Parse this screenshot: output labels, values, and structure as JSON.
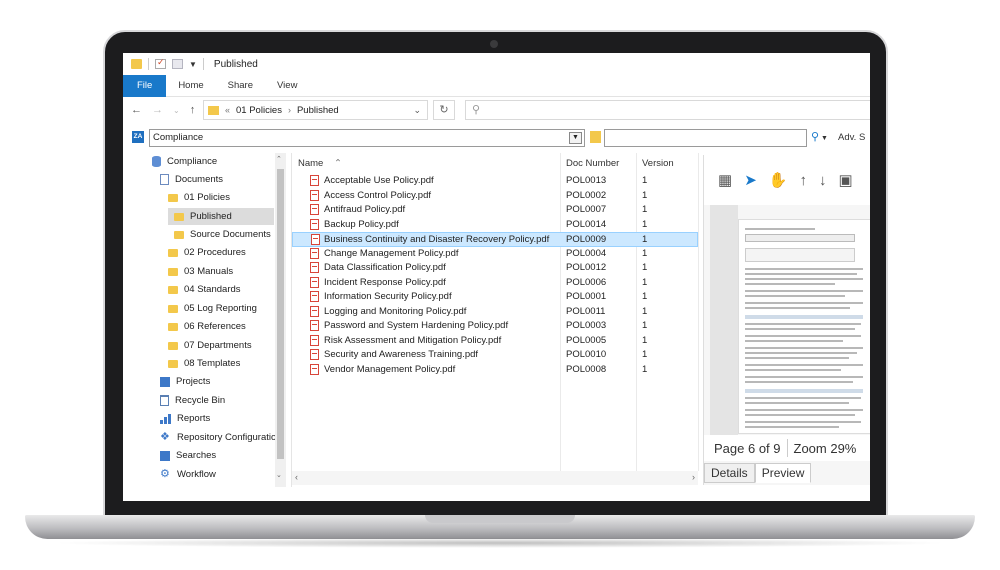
{
  "window": {
    "title": "Published"
  },
  "ribbon": {
    "tabs": [
      "File",
      "Home",
      "Share",
      "View"
    ]
  },
  "address": {
    "path": [
      "01 Policies",
      "Published"
    ]
  },
  "compliance_bar": {
    "repository": "Compliance",
    "logo": "ZA",
    "advanced_label": "Adv. S"
  },
  "nav_pane": {
    "items": [
      {
        "label": "Compliance",
        "icon": "database-icon"
      },
      {
        "label": "Documents",
        "icon": "document-icon"
      },
      {
        "label": "01 Policies",
        "icon": "folder-icon"
      },
      {
        "label": "Published",
        "icon": "folder-icon",
        "selected": true
      },
      {
        "label": "Source Documents",
        "icon": "folder-icon"
      },
      {
        "label": "02 Procedures",
        "icon": "folder-icon"
      },
      {
        "label": "03 Manuals",
        "icon": "folder-icon"
      },
      {
        "label": "04 Standards",
        "icon": "folder-icon"
      },
      {
        "label": "05 Log Reporting",
        "icon": "folder-icon"
      },
      {
        "label": "06 References",
        "icon": "folder-icon"
      },
      {
        "label": "07 Departments",
        "icon": "folder-icon"
      },
      {
        "label": "08 Templates",
        "icon": "folder-icon"
      },
      {
        "label": "Projects",
        "icon": "projects-icon"
      },
      {
        "label": "Recycle Bin",
        "icon": "recycle-bin-icon"
      },
      {
        "label": "Reports",
        "icon": "bar-chart-icon"
      },
      {
        "label": "Repository Configuration",
        "icon": "config-icon"
      },
      {
        "label": "Searches",
        "icon": "search-folder-icon"
      },
      {
        "label": "Workflow",
        "icon": "gear-icon"
      }
    ]
  },
  "file_list": {
    "columns": [
      "Name",
      "Doc Number",
      "Version"
    ],
    "rows": [
      {
        "name": "Acceptable Use Policy.pdf",
        "doc": "POL0013",
        "version": "1"
      },
      {
        "name": "Access Control Policy.pdf",
        "doc": "POL0002",
        "version": "1"
      },
      {
        "name": "Antifraud Policy.pdf",
        "doc": "POL0007",
        "version": "1"
      },
      {
        "name": "Backup Policy.pdf",
        "doc": "POL0014",
        "version": "1"
      },
      {
        "name": "Business Continuity and Disaster Recovery Policy.pdf",
        "doc": "POL0009",
        "version": "1",
        "selected": true
      },
      {
        "name": "Change Management Policy.pdf",
        "doc": "POL0004",
        "version": "1"
      },
      {
        "name": "Data Classification Policy.pdf",
        "doc": "POL0012",
        "version": "1"
      },
      {
        "name": "Incident Response Policy.pdf",
        "doc": "POL0006",
        "version": "1"
      },
      {
        "name": "Information Security Policy.pdf",
        "doc": "POL0001",
        "version": "1"
      },
      {
        "name": "Logging and Monitoring Policy.pdf",
        "doc": "POL0011",
        "version": "1"
      },
      {
        "name": "Password and System Hardening Policy.pdf",
        "doc": "POL0003",
        "version": "1"
      },
      {
        "name": "Risk Assessment and Mitigation Policy.pdf",
        "doc": "POL0005",
        "version": "1"
      },
      {
        "name": "Security and Awareness Training.pdf",
        "doc": "POL0010",
        "version": "1"
      },
      {
        "name": "Vendor Management Policy.pdf",
        "doc": "POL0008",
        "version": "1"
      }
    ]
  },
  "preview": {
    "page_status": "Page 6 of 9",
    "zoom_status": "Zoom 29%",
    "tabs": [
      "Details",
      "Preview"
    ],
    "active_tab": "Preview"
  },
  "colors": {
    "accent": "#1979ca",
    "selection": "#cce8ff",
    "folder": "#f3c84b",
    "pdf": "#d8453a"
  }
}
